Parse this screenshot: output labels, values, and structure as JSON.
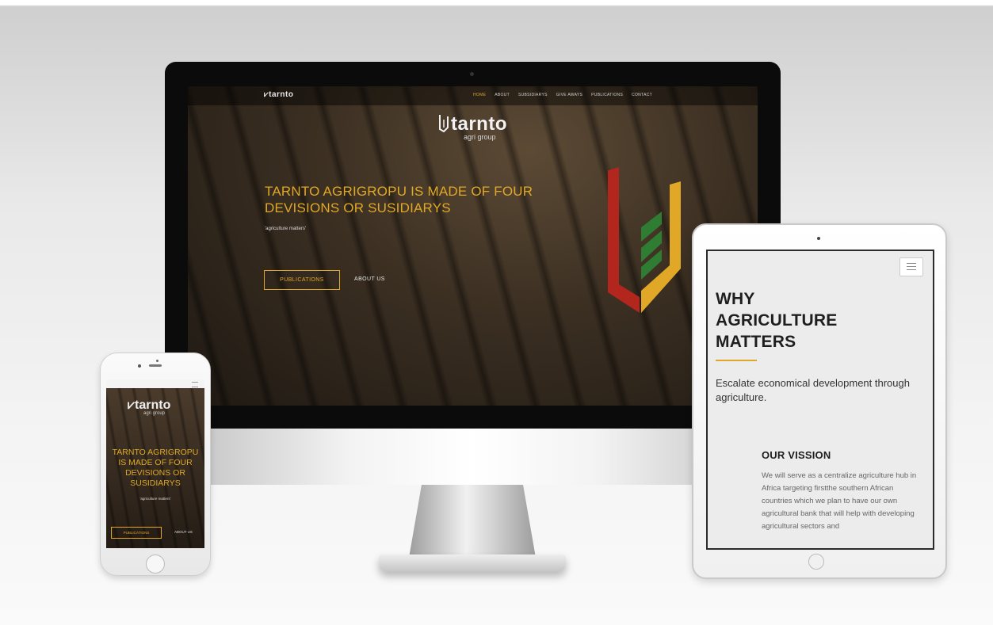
{
  "desktop": {
    "nav": {
      "logo": "tarnto",
      "links": [
        "HOME",
        "ABOUT",
        "SUBSIDIARYS",
        "GIVE AWAYS",
        "PUBLICATIONS",
        "CONTACT"
      ],
      "active_link": "HOME"
    },
    "brand": {
      "name": "tarnto",
      "tagline": "agri group"
    },
    "hero": {
      "title": "TARNTO AGRIGROPU IS MADE OF FOUR DEVISIONS OR SUSIDIARYS",
      "subtitle": "'agriculture matters'",
      "primary_button": "PUBLICATIONS",
      "secondary_button": "ABOUT US"
    }
  },
  "phone": {
    "brand": {
      "name": "tarnto",
      "tagline": "agri group"
    },
    "title": "TARNTO AGRIGROPU IS MADE OF FOUR DEVISIONS OR SUSIDIARYS",
    "subtitle": "'agriculture matters'",
    "primary_button": "PUBLICATIONS",
    "secondary_button": "ABOUT US",
    "menu_icon": "hamburger-icon"
  },
  "tablet": {
    "menu_icon": "hamburger-icon",
    "heading": "WHY AGRICULTURE MATTERS",
    "lead": "Escalate economical development through agriculture.",
    "vision_title": "OUR VISSION",
    "vision_body": "We will serve as a centralize agriculture hub in Africa targeting firstthe southern African countries which we plan to have our own agricultural bank that will help with developing agricultural sectors and"
  },
  "colors": {
    "accent": "#e0a826",
    "logo_red": "#b3261e",
    "logo_green": "#2e7d32",
    "logo_yellow": "#e0a826",
    "screen_soil": "#3b2f22"
  }
}
